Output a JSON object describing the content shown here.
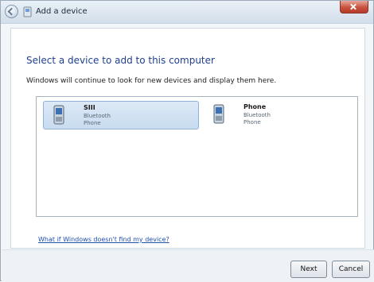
{
  "window": {
    "title": "Add a device"
  },
  "heading": "Select a device to add to this computer",
  "instruction": "Windows will continue to look for new devices and display them here.",
  "devices": [
    {
      "name": "SIII",
      "type": "Bluetooth",
      "category": "Phone",
      "selected": true
    },
    {
      "name": "Phone",
      "type": "Bluetooth",
      "category": "Phone",
      "selected": false
    }
  ],
  "help_link": "What if Windows doesn't find my device?",
  "buttons": {
    "next": "Next",
    "cancel": "Cancel"
  },
  "icons": {
    "back": "back-arrow-icon",
    "wizard": "add-device-icon",
    "close": "close-icon",
    "device": "phone-icon"
  }
}
